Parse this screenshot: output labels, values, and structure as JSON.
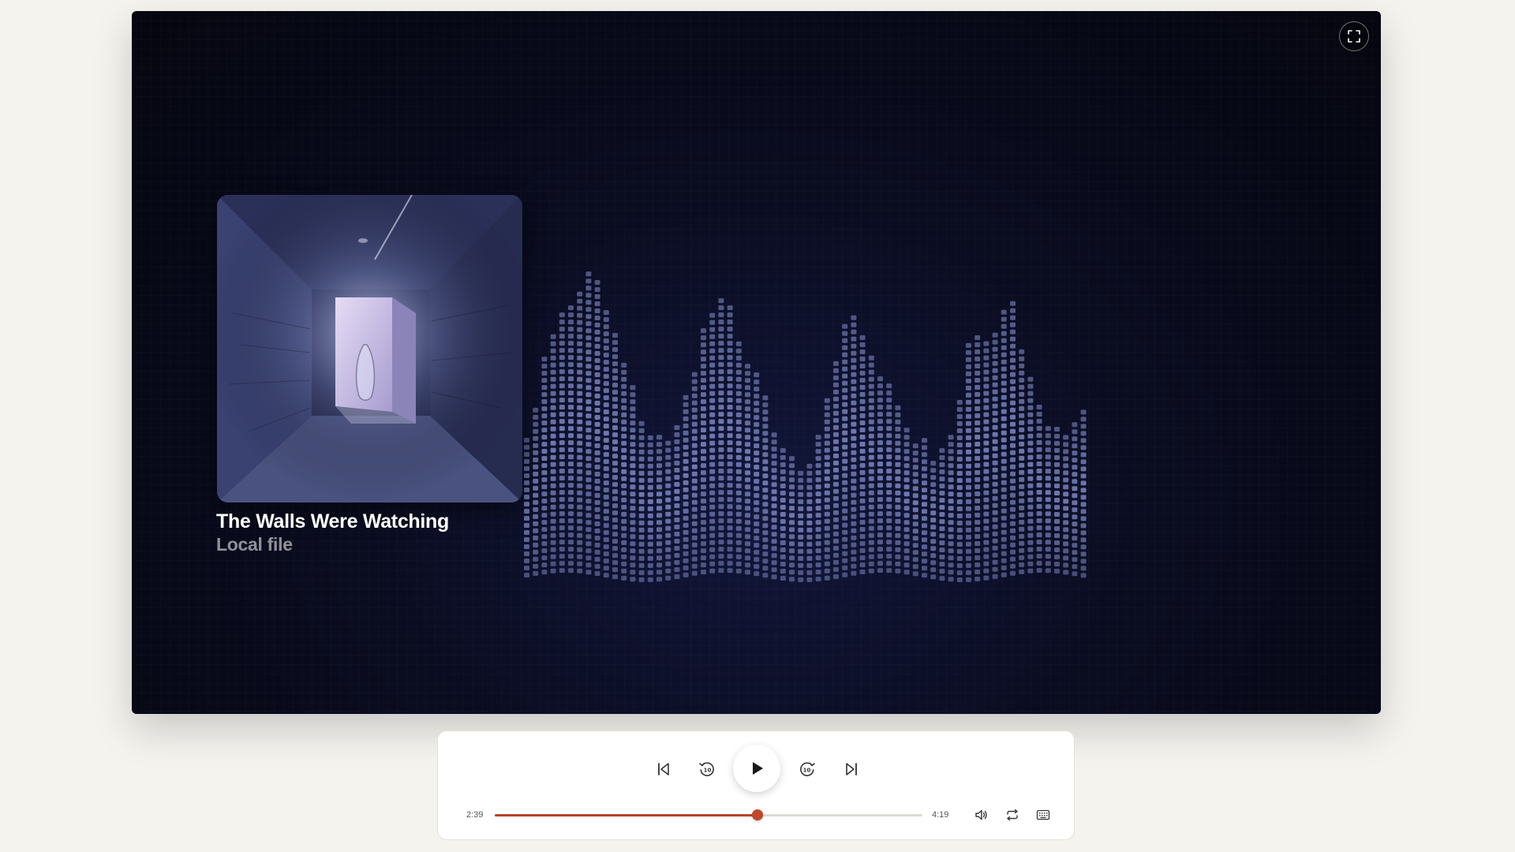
{
  "track": {
    "title": "The Walls Were Watching",
    "source": "Local file"
  },
  "playback": {
    "current_time": "2:39",
    "duration": "4:19",
    "progress_fraction": 0.614,
    "state": "paused"
  },
  "icons": {
    "fullscreen": "fullscreen-icon",
    "previous": "skip-previous-icon",
    "rewind": "rewind-10-icon",
    "play": "play-icon",
    "forward": "forward-10-icon",
    "next": "skip-next-icon",
    "volume": "volume-icon",
    "repeat": "repeat-icon",
    "keyboard": "keyboard-icon"
  },
  "colors": {
    "accent": "#c0462c",
    "page_background": "#f5f3ee",
    "stage_background": "#05060f",
    "visualizer_dot": "#7f8ac4"
  },
  "visualizer": {
    "levels": [
      0.42,
      0.52,
      0.66,
      0.72,
      0.78,
      0.8,
      0.85,
      0.9,
      0.88,
      0.8,
      0.74,
      0.66,
      0.6,
      0.5,
      0.46,
      0.45,
      0.43,
      0.47,
      0.55,
      0.62,
      0.74,
      0.78,
      0.82,
      0.8,
      0.7,
      0.64,
      0.62,
      0.55,
      0.44,
      0.4,
      0.38,
      0.35,
      0.37,
      0.46,
      0.55,
      0.66,
      0.76,
      0.78,
      0.72,
      0.66,
      0.6,
      0.58,
      0.52,
      0.46,
      0.4,
      0.42,
      0.37,
      0.4,
      0.46,
      0.55,
      0.72,
      0.74,
      0.73,
      0.75,
      0.8,
      0.82,
      0.68,
      0.6,
      0.52,
      0.46,
      0.44,
      0.42,
      0.48,
      0.52
    ]
  }
}
